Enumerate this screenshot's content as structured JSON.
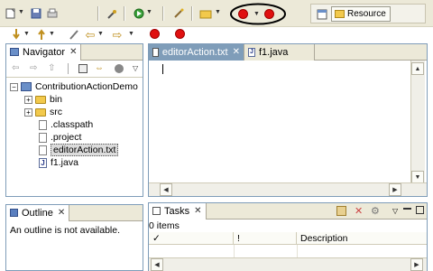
{
  "perspective": {
    "resource_label": "Resource"
  },
  "navigator": {
    "title": "Navigator",
    "tree": [
      {
        "label": "ContributionActionDemo",
        "icon": "project-icon"
      },
      {
        "label": "bin",
        "icon": "folder-icon"
      },
      {
        "label": "src",
        "icon": "folder-icon"
      },
      {
        "label": ".classpath",
        "icon": "file-icon"
      },
      {
        "label": ".project",
        "icon": "file-icon"
      },
      {
        "label": "editorAction.txt",
        "icon": "file-icon",
        "selected": true
      },
      {
        "label": "f1.java",
        "icon": "java-file-icon"
      }
    ]
  },
  "editor": {
    "tabs": [
      {
        "label": "editorAction.txt",
        "active": true
      },
      {
        "label": "f1.java",
        "active": false
      }
    ]
  },
  "outline": {
    "title": "Outline",
    "message": "An outline is not available."
  },
  "tasks": {
    "title": "Tasks",
    "count_text": "0 items",
    "columns": [
      "✓",
      "!",
      "Description"
    ]
  },
  "colors": {
    "toolbar_bg": "#ece9d8",
    "pane_border": "#7f9db9",
    "red_button": "#e01010",
    "annotation_circle": "#000000"
  }
}
